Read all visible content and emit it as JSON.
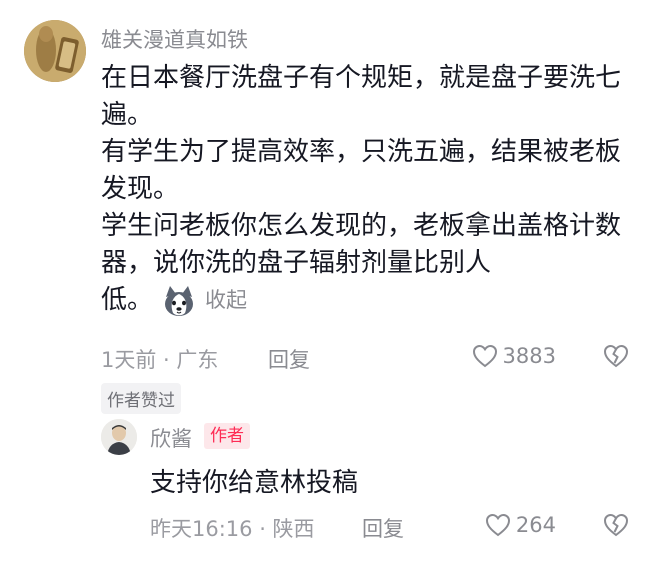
{
  "comment": {
    "username": "雄关漫道真如铁",
    "text_lines": [
      "在日本餐厅洗盘子有个规矩，就是盘子要洗七遍。",
      "有学生为了提高效率，只洗五遍，结果被老板发现。",
      "学生问老板你怎么发现的，老板拿出盖格计数器，说你洗的盘子辐射剂量比别人"
    ],
    "last_fragment": "低。",
    "emoji": "husky-emoji",
    "collapse_label": "收起",
    "time_location": "1天前 · 广东",
    "reply_label": "回复",
    "like_count": "3883",
    "author_liked_label": "作者赞过"
  },
  "reply": {
    "username": "欣酱",
    "author_badge": "作者",
    "text": "支持你给意林投稿",
    "time_location": "昨天16:16 · 陕西",
    "reply_label": "回复",
    "like_count": "264"
  },
  "colors": {
    "secondary_text": "#8a8b91",
    "badge_text": "#fe2c55",
    "badge_bg": "#fde7ea"
  }
}
